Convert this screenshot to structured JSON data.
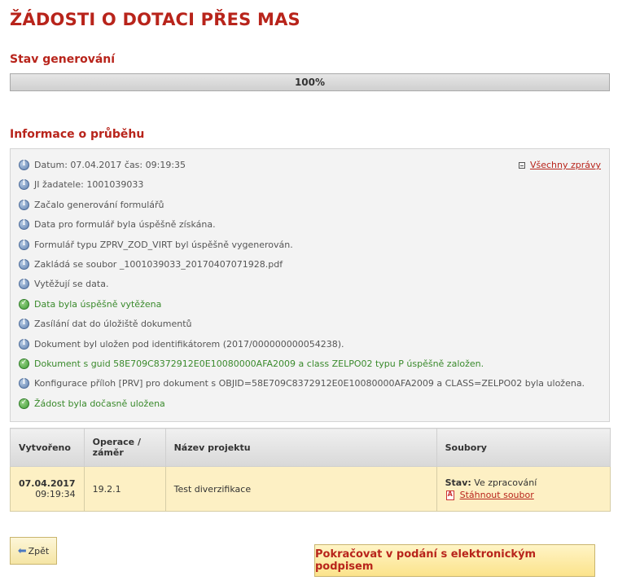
{
  "page": {
    "title": "ŽÁDOSTI O DOTACI PŘES MAS",
    "status_heading": "Stav generování",
    "progress_label": "100%",
    "progress_percent": 100,
    "info_heading": "Informace o průběhu"
  },
  "log": {
    "all_messages_label": "Všechny zprávy",
    "lines": [
      {
        "type": "info",
        "icon": "info-icon",
        "text": "Datum: 07.04.2017 čas: 09:19:35"
      },
      {
        "type": "info",
        "icon": "info-icon",
        "text": "JI žadatele: 1001039033"
      },
      {
        "type": "info",
        "icon": "info-icon",
        "text": "Začalo generování formulářů"
      },
      {
        "type": "info",
        "icon": "info-icon",
        "text": "Data pro formulář byla úspěšně získána."
      },
      {
        "type": "info",
        "icon": "info-icon",
        "text": "Formulář typu ZPRV_ZOD_VIRT byl úspěšně vygenerován."
      },
      {
        "type": "info",
        "icon": "info-icon",
        "text": "Zakládá se soubor _1001039033_20170407071928.pdf"
      },
      {
        "type": "info",
        "icon": "info-icon",
        "text": "Vytěžují se data."
      },
      {
        "type": "ok",
        "icon": "check-icon",
        "text": "Data byla úspěšně vytěžena"
      },
      {
        "type": "info",
        "icon": "info-icon",
        "text": "Zasílání dat do úložiště dokumentů"
      },
      {
        "type": "info",
        "icon": "info-icon",
        "text": "Dokument byl uložen pod identifikátorem (2017/000000000054238)."
      },
      {
        "type": "ok",
        "icon": "check-icon",
        "text": "Dokument s guid 58E709C8372912E0E10080000AFA2009 a class ZELPO02 typu P úspěšně založen."
      },
      {
        "type": "info",
        "icon": "info-icon",
        "text": "Konfigurace příloh [PRV] pro dokument s OBJID=58E709C8372912E0E10080000AFA2009 a CLASS=ZELPO02 byla uložena."
      },
      {
        "type": "ok",
        "icon": "check-icon",
        "text": "Žádost byla dočasně uložena"
      }
    ]
  },
  "table": {
    "headers": [
      "Vytvořeno",
      "Operace / záměr",
      "Název projektu",
      "Soubory"
    ],
    "row": {
      "date": "07.04.2017",
      "time": "09:19:34",
      "operation": "19.2.1",
      "project_name": "Test diverzifikace",
      "status_label": "Stav:",
      "status_value": "Ve zpracování",
      "download_label": "Stáhnout soubor"
    }
  },
  "buttons": {
    "back": "Zpět",
    "continue": "Pokračovat v podání s elektronickým podpisem"
  },
  "colors": {
    "accent": "#b8241b",
    "success": "#3a8a2c",
    "row_highlight": "#fdf0c4"
  }
}
